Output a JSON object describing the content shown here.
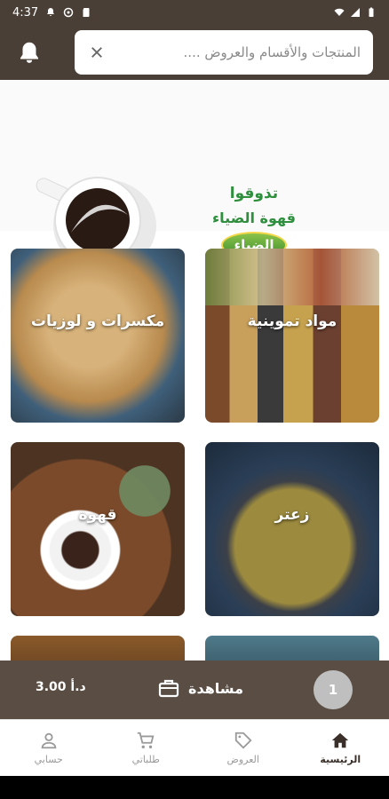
{
  "status_bar": {
    "time": "4:37"
  },
  "search": {
    "placeholder": "المنتجات والأقسام والعروض ...."
  },
  "banner": {
    "line1": "تذوقوا",
    "line2": "قهوة الضياء",
    "logo": "الضياء"
  },
  "categories": [
    {
      "label": "مكسرات و لوزيات"
    },
    {
      "label": "مواد تموينية"
    },
    {
      "label": "قهوة"
    },
    {
      "label": "زعتر"
    }
  ],
  "cart": {
    "count": "1",
    "view_label": "مشاهدة",
    "total": "3.00 د.أ"
  },
  "bottom_nav": [
    {
      "label": "حسابي",
      "icon": "person-icon"
    },
    {
      "label": "طلباتي",
      "icon": "cart-icon"
    },
    {
      "label": "العروض",
      "icon": "tag-icon"
    },
    {
      "label": "الرئيسية",
      "icon": "home-icon"
    }
  ],
  "colors": {
    "header": "#4a3f37",
    "cartbar": "#5a4d44",
    "accent_green": "#2f8f3f"
  }
}
